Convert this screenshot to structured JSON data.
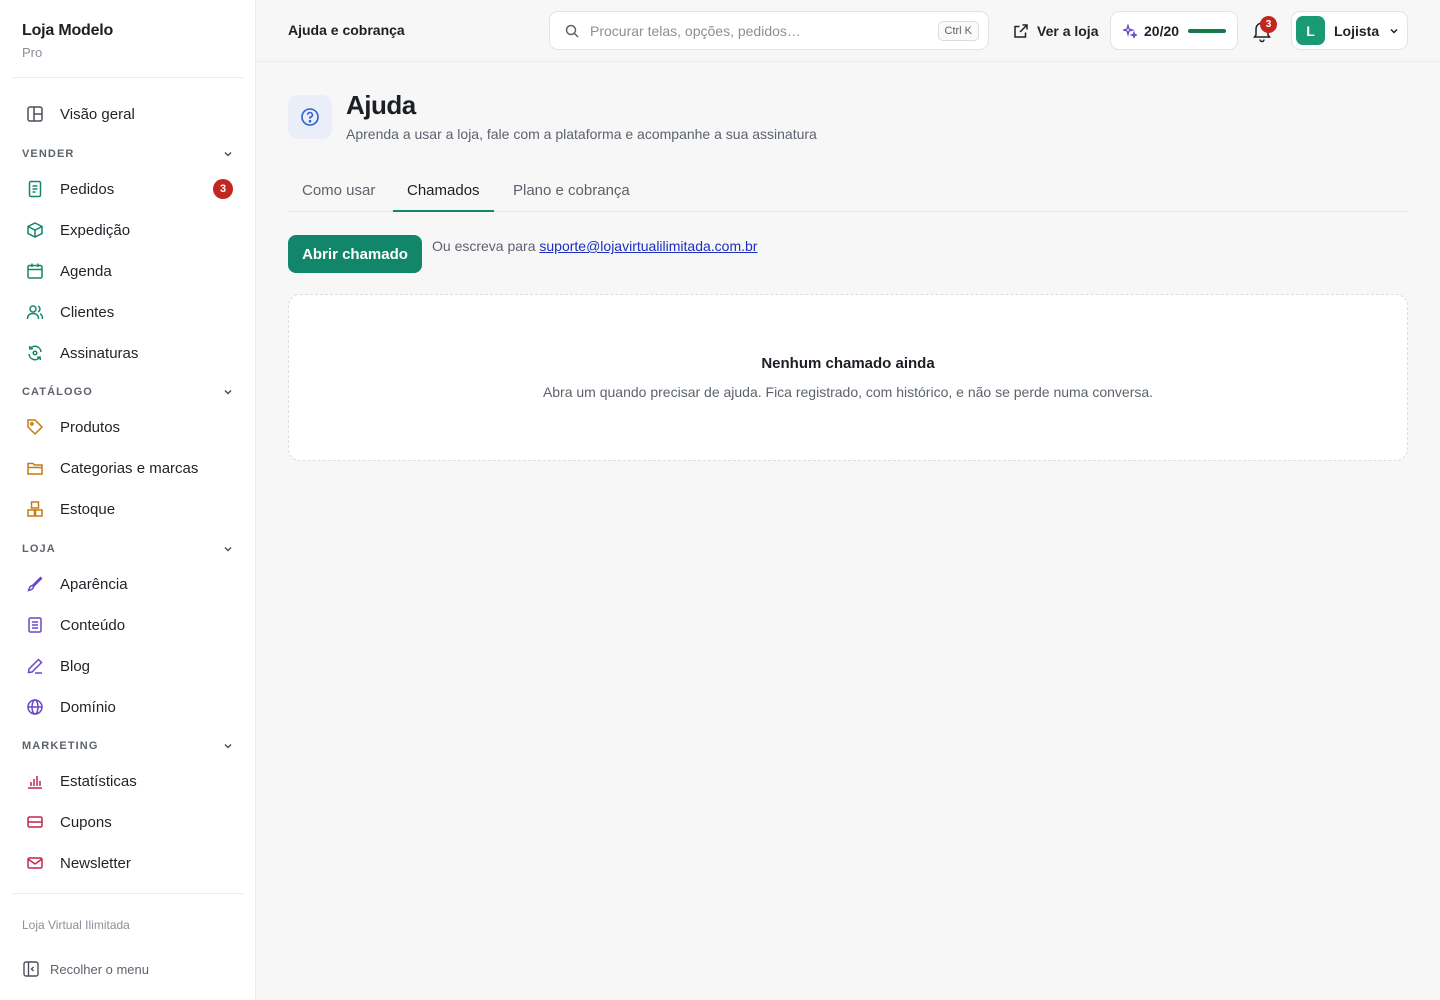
{
  "brand": {
    "name": "Loja Modelo",
    "plan": "Pro"
  },
  "sidebar": {
    "overview": {
      "label": "Visão geral",
      "icon": "layout-icon"
    },
    "sections": {
      "sell": {
        "title": "VENDER"
      },
      "catalog": {
        "title": "CATÁLOGO"
      },
      "store": {
        "title": "LOJA"
      },
      "marketing": {
        "title": "MARKETING"
      }
    },
    "items": {
      "orders": {
        "label": "Pedidos",
        "badge": "3",
        "icon": "receipt-icon"
      },
      "shipping": {
        "label": "Expedição",
        "icon": "box-icon"
      },
      "schedule": {
        "label": "Agenda",
        "icon": "calendar-icon"
      },
      "customers": {
        "label": "Clientes",
        "icon": "users-icon"
      },
      "subscriptions": {
        "label": "Assinaturas",
        "icon": "refresh-icon"
      },
      "products": {
        "label": "Produtos",
        "icon": "tag-icon"
      },
      "categories": {
        "label": "Categorias e marcas",
        "icon": "folder-icon"
      },
      "stock": {
        "label": "Estoque",
        "icon": "boxes-icon"
      },
      "appearance": {
        "label": "Aparência",
        "icon": "brush-icon"
      },
      "content": {
        "label": "Conteúdo",
        "icon": "document-icon"
      },
      "blog": {
        "label": "Blog",
        "icon": "pen-icon"
      },
      "domain": {
        "label": "Domínio",
        "icon": "globe-icon"
      },
      "stats": {
        "label": "Estatísticas",
        "icon": "bar-chart-icon"
      },
      "coupons": {
        "label": "Cupons",
        "icon": "ticket-icon"
      },
      "newsletter": {
        "label": "Newsletter",
        "icon": "mail-icon"
      }
    },
    "footer_store": "Loja Virtual Ilimitada",
    "collapse_label": "Recolher o menu"
  },
  "topbar": {
    "breadcrumb": "Ajuda e cobrança",
    "search_placeholder": "Procurar telas, opções, pedidos…",
    "search_shortcut": "Ctrl K",
    "view_store": "Ver a loja",
    "quota": "20/20",
    "quota_fraction": 1.0,
    "notifications_count": "3",
    "user_initial": "L",
    "user_name": "Lojista"
  },
  "page": {
    "title": "Ajuda",
    "subtitle": "Aprenda a usar a loja, fale com a plataforma e acompanhe a sua assinatura",
    "tabs": [
      "Como usar",
      "Chamados",
      "Plano e cobrança"
    ],
    "active_tab": "Chamados",
    "open_ticket_button": "Abrir chamado",
    "or_write_prefix": "Ou escreva para",
    "support_email": "suporte@lojavirtualilimitada.com.br",
    "empty_title": "Nenhum chamado ainda",
    "empty_desc": "Abra um quando precisar de ajuda. Fica registrado, com histórico, e não se perde numa conversa."
  },
  "colors": {
    "accent": "#12866b",
    "badge": "#c2271f",
    "link": "#1d2fbf"
  }
}
